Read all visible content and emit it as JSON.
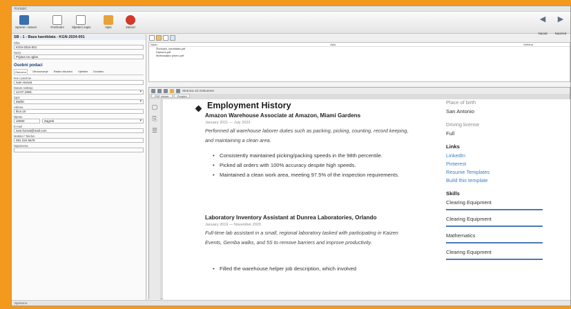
{
  "window": {
    "title": "Kontakt"
  },
  "toolbar": {
    "buttons": [
      {
        "label": "Spremi i zatvori",
        "icon": "save-icon",
        "color": "#3a6fb0"
      },
      {
        "label": "Prethodni",
        "icon": "document-icon",
        "color": "#d8d8d8"
      },
      {
        "label": "Sljedeći zapis",
        "icon": "document-icon",
        "color": "#d8d8d8"
      },
      {
        "label": "Ispis",
        "icon": "printer-icon",
        "color": "#e8a23a"
      },
      {
        "label": "Zatvori",
        "icon": "close-icon",
        "color": "#d2382c"
      }
    ],
    "nav_back": "Nazad",
    "nav_forward": "Naprijed"
  },
  "left": {
    "header": "SB - 1 - Baza kandidata - KGN-2024-001",
    "fields_top": [
      {
        "caption": "Šifra",
        "value": "KGN-2024-001"
      },
      {
        "caption": "Naziv",
        "value": "Prijava na oglas"
      }
    ],
    "section_title": "Osobni podaci",
    "tabs": [
      "Osnovno",
      "Obrazovanje",
      "Radno iskustvo",
      "Vještine",
      "Dodatno"
    ],
    "fields": [
      {
        "caption": "Ime i prezime",
        "value": "Ivan Horvat"
      },
      {
        "caption": "Datum rođenja",
        "value": "14.07.1993."
      },
      {
        "caption": "Spol",
        "value": "Muški"
      },
      {
        "caption": "Adresa",
        "value": "Ilica 10"
      },
      {
        "caption": "Mjesto",
        "value": "10000",
        "value2": "Zagreb"
      },
      {
        "caption": "E-mail",
        "value": "ivan.horvat@mail.com"
      },
      {
        "caption": "Mobitel / Telefon",
        "value": "091 234 5678"
      }
    ],
    "notes_caption": "Napomena"
  },
  "attachments": {
    "columns": [
      "Naziv",
      "Opis",
      "Veličina"
    ],
    "rows": [
      "Životopis_kandidata.pdf",
      "Diploma.pdf",
      "Motivacijsko pismo.pdf"
    ]
  },
  "viewer": {
    "toolbar_label": "Stranica 1/1  Dokument",
    "tabs": [
      "PDF viewer",
      "Pregled"
    ],
    "doc": {
      "section_title": "Employment History",
      "jobs": [
        {
          "title": "Amazon Warehouse Associate at Amazon, Miami Gardens",
          "date": "January 2021 — July 2023",
          "desc": "Performed all warehouse laborer duties such as packing, picking, counting, record keeping, and maintaining a clean area.",
          "bullets": [
            "Consistently maintained picking/packing speeds in the 98th percentile.",
            "Picked all orders with 100% accuracy despite high speeds.",
            "Maintained a clean work area, meeting 97.5% of the inspection requirements."
          ]
        },
        {
          "title": "Laboratory Inventory Assistant  at  Dunrea Laboratories, Orlando",
          "date": "January 2019 — November 2020",
          "desc": "Full-time lab assistant in a small, regional laboratory tasked with participating in Kaizen Events, Gemba walks, and 5S to remove barriers and improve productivity.",
          "bullets": [
            "Filled the warehouse helper job description, which involved"
          ]
        }
      ],
      "side": {
        "place_label": "Place of birth",
        "place_value": "San Antonio",
        "license_label": "Driving license",
        "license_value": "Full",
        "links_heading": "Links",
        "links": [
          "LinkedIn",
          "Pinterest",
          "Resume Templates",
          "Build this template"
        ],
        "skills_heading": "Skills",
        "skills": [
          "Clearing Equipment",
          "Clearing Equipment",
          "Mathematics",
          "Clearing Equipment"
        ]
      }
    }
  },
  "status": {
    "text": "Spremno"
  }
}
